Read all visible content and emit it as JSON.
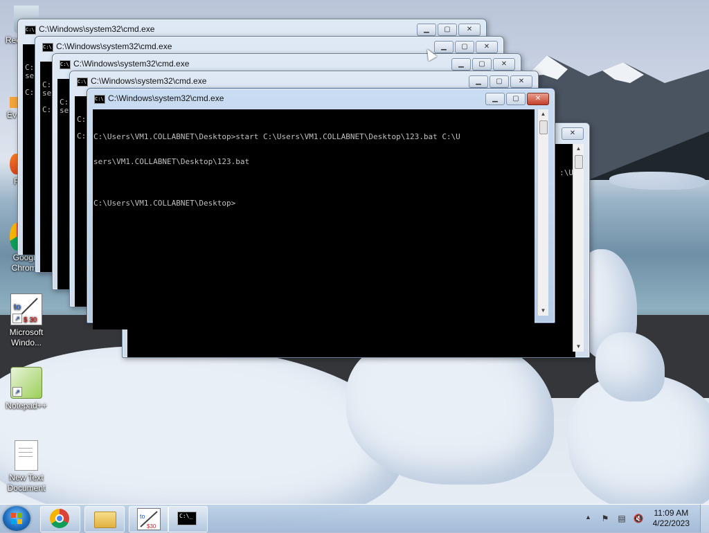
{
  "desktop": {
    "icons": [
      {
        "label": "Rec",
        "name": "recycle-bin"
      },
      {
        "label": "Ev",
        "name": "everything"
      },
      {
        "label": "F",
        "name": "firefox"
      },
      {
        "label": "Google Chrome",
        "name": "google-chrome"
      },
      {
        "label": "Microsoft Windo...",
        "name": "microsoft-windows-tool"
      },
      {
        "label": "Notepad++",
        "name": "notepad-plus-plus"
      },
      {
        "label": "New Text Document",
        "name": "new-text-document"
      }
    ]
  },
  "windows": {
    "title": "C:\\Windows\\system32\\cmd.exe",
    "background_lines": [
      "C:",
      "se",
      "C:"
    ],
    "front_console": [
      "C:\\Users\\VM1.COLLABNET\\Desktop>start C:\\Users\\VM1.COLLABNET\\Desktop\\123.bat C:\\U",
      "sers\\VM1.COLLABNET\\Desktop\\123.bat",
      "",
      "C:\\Users\\VM1.COLLABNET\\Desktop>"
    ],
    "back_fragment": ":\\U"
  },
  "taskbar": {
    "clock_time": "11:09 AM",
    "clock_date": "4/22/2023",
    "tray_arrow": "▲"
  },
  "colors": {
    "console_bg": "#000000",
    "console_text": "#c0c0c0",
    "close_red": "#c4402a"
  }
}
